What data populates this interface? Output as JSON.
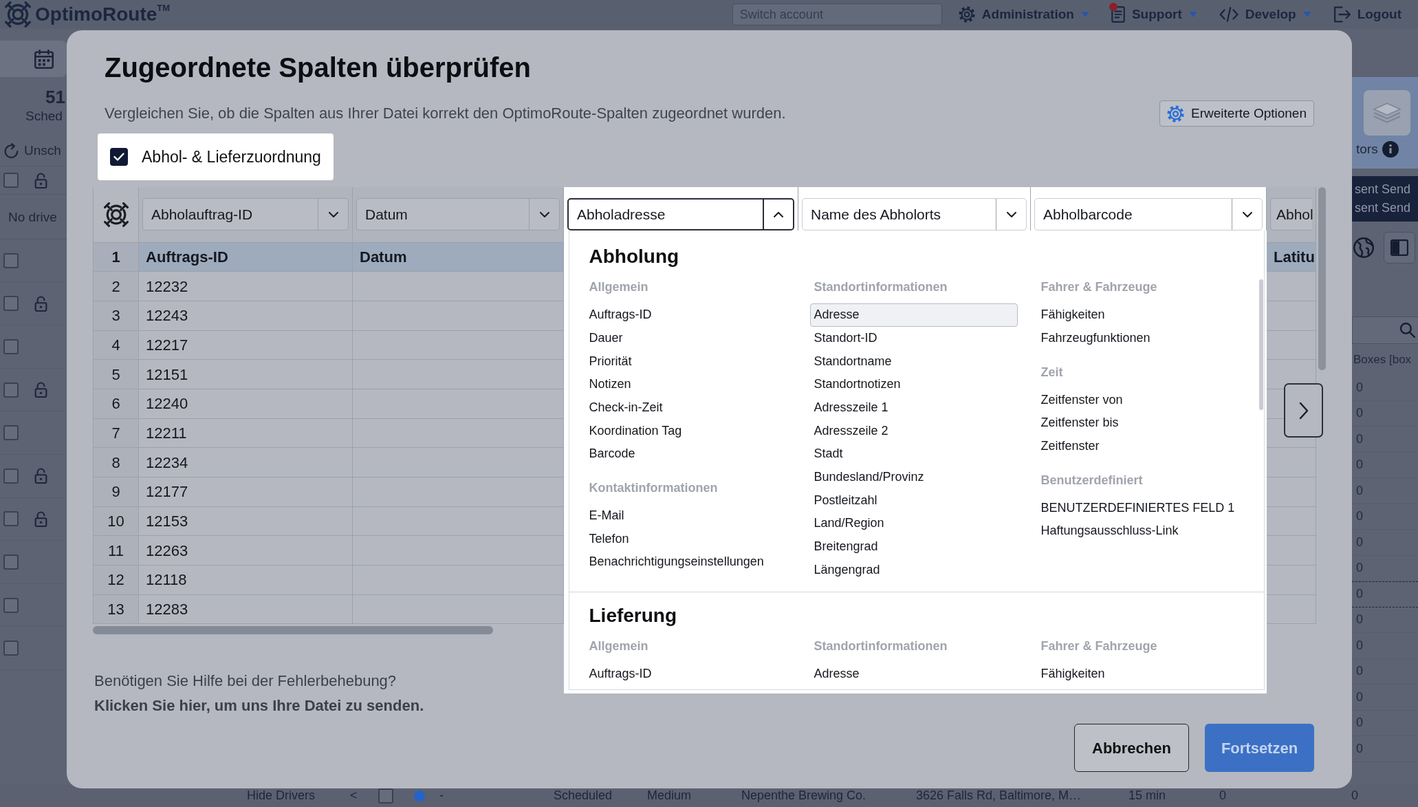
{
  "app": {
    "logo": "OptimoRoute$^{TM}$",
    "account_search": {
      "placeholder": "Switch account"
    },
    "menu": [
      {
        "label": "Administration",
        "dropdown": true,
        "notification": false
      },
      {
        "label": "Support",
        "dropdown": true,
        "notification": true
      },
      {
        "label": "Develop",
        "dropdown": true,
        "notification": false
      },
      {
        "label": "Logout",
        "dropdown": false,
        "notification": false
      }
    ],
    "left_panel": {
      "stat_value": "51",
      "stat_label": "Sched",
      "filter_label": "Unsch",
      "header_row": {
        "checked": false,
        "locked": true
      },
      "empty_text": "No drive",
      "rows": [
        {
          "checked": false,
          "locked": false
        },
        {
          "checked": false,
          "locked": true
        },
        {
          "checked": false,
          "locked": false
        },
        {
          "checked": false,
          "locked": true
        },
        {
          "checked": false,
          "locked": false
        },
        {
          "checked": false,
          "locked": true
        },
        {
          "checked": false,
          "locked": true
        },
        {
          "checked": false,
          "locked": false
        },
        {
          "checked": false,
          "locked": false
        },
        {
          "checked": false,
          "locked": false
        }
      ]
    },
    "right_panel": {
      "label": "tors",
      "notices": [
        {
          "text": "sent",
          "link": "Send"
        },
        {
          "text": "sent",
          "link": "Send"
        }
      ],
      "column_heading": "Boxes [box",
      "values": [
        {
          "text": "0",
          "highlighted": false
        },
        {
          "text": "0",
          "highlighted": false
        },
        {
          "text": "0",
          "highlighted": false
        },
        {
          "text": "0",
          "highlighted": false
        },
        {
          "text": "0",
          "highlighted": false
        },
        {
          "text": "0",
          "highlighted": false
        },
        {
          "text": "0",
          "highlighted": false
        },
        {
          "text": "0",
          "highlighted": false
        },
        {
          "text": "0",
          "highlighted": true
        },
        {
          "text": "0",
          "highlighted": false
        },
        {
          "text": "0",
          "highlighted": false
        },
        {
          "text": "0",
          "highlighted": false
        },
        {
          "text": "0",
          "highlighted": false
        },
        {
          "text": "0",
          "highlighted": false
        },
        {
          "text": "0",
          "highlighted": false
        }
      ]
    },
    "bottom_row": {
      "toggle": "Hide Drivers",
      "pager": "<",
      "checked": false,
      "color": "#2563c9",
      "cells": [
        "-",
        "Scheduled",
        "Medium",
        "Nepenthe Brewing Co.",
        "3626 Falls Rd, Baltimore, M…",
        "15 min",
        "0"
      ],
      "end_value": "0"
    }
  },
  "modal": {
    "title": "Zugeordnete Spalten überprüfen",
    "subtitle": "Vergleichen Sie, ob die Spalten aus Ihrer Datei korrekt den OptimoRoute-Spalten zugeordnet wurden.",
    "options_button": "Erweiterte Optionen",
    "mapping_toggle": {
      "label": "Abhol- & Lieferzuordnung",
      "checked": true
    },
    "table": {
      "columns": [
        {
          "select": "Abholauftrag-ID",
          "expanded": false,
          "highlighted": false
        },
        {
          "select": "Datum",
          "expanded": false,
          "highlighted": false
        },
        {
          "select": "Abholadresse",
          "expanded": true,
          "highlighted": true
        },
        {
          "select": "Name des Abholorts",
          "expanded": false,
          "highlighted": true
        },
        {
          "select": "Abholbarcode",
          "expanded": false,
          "highlighted": true
        },
        {
          "select": "Abhol",
          "highlighted": false
        }
      ],
      "rows": [
        {
          "number": "1",
          "header": true,
          "order_id": "Auftrags-ID",
          "date": "Datum",
          "column_6": "Latitu"
        },
        {
          "number": "2",
          "header": false,
          "order_id": "12232"
        },
        {
          "number": "3",
          "header": false,
          "order_id": "12243"
        },
        {
          "number": "4",
          "header": false,
          "order_id": "12217"
        },
        {
          "number": "5",
          "header": false,
          "order_id": "12151"
        },
        {
          "number": "6",
          "header": false,
          "order_id": "12240"
        },
        {
          "number": "7",
          "header": false,
          "order_id": "12211"
        },
        {
          "number": "8",
          "header": false,
          "order_id": "12234"
        },
        {
          "number": "9",
          "header": false,
          "order_id": "12177"
        },
        {
          "number": "10",
          "header": false,
          "order_id": "12153"
        },
        {
          "number": "11",
          "header": false,
          "order_id": "12263"
        },
        {
          "number": "12",
          "header": false,
          "order_id": "12118"
        },
        {
          "number": "13",
          "header": false,
          "order_id": "12283"
        }
      ]
    },
    "dropdown": {
      "sections": [
        {
          "title": "Abholung",
          "columns": [
            {
              "groups": [
                {
                  "heading": "Allgemein",
                  "items": [
                    {
                      "label": "Auftrags-ID",
                      "selected": false
                    },
                    {
                      "label": "Dauer",
                      "selected": false
                    },
                    {
                      "label": "Priorität",
                      "selected": false
                    },
                    {
                      "label": "Notizen",
                      "selected": false
                    },
                    {
                      "label": "Check-in-Zeit",
                      "selected": false
                    },
                    {
                      "label": "Koordination Tag",
                      "selected": false
                    },
                    {
                      "label": "Barcode",
                      "selected": false
                    }
                  ]
                },
                {
                  "heading": "Kontaktinformationen",
                  "items": [
                    {
                      "label": "E-Mail",
                      "selected": false
                    },
                    {
                      "label": "Telefon",
                      "selected": false
                    },
                    {
                      "label": "Benachrichtigungseinstellungen",
                      "selected": false
                    }
                  ]
                }
              ]
            },
            {
              "groups": [
                {
                  "heading": "Standortinformationen",
                  "items": [
                    {
                      "label": "Adresse",
                      "selected": true
                    },
                    {
                      "label": "Standort-ID",
                      "selected": false
                    },
                    {
                      "label": "Standortname",
                      "selected": false
                    },
                    {
                      "label": "Standortnotizen",
                      "selected": false
                    },
                    {
                      "label": "Adresszeile 1",
                      "selected": false
                    },
                    {
                      "label": "Adresszeile 2",
                      "selected": false
                    },
                    {
                      "label": "Stadt",
                      "selected": false
                    },
                    {
                      "label": "Bundesland/Provinz",
                      "selected": false
                    },
                    {
                      "label": "Postleitzahl",
                      "selected": false
                    },
                    {
                      "label": "Land/Region",
                      "selected": false
                    },
                    {
                      "label": "Breitengrad",
                      "selected": false
                    },
                    {
                      "label": "Längengrad",
                      "selected": false
                    }
                  ]
                }
              ]
            },
            {
              "groups": [
                {
                  "heading": "Fahrer & Fahrzeuge",
                  "items": [
                    {
                      "label": "Fähigkeiten",
                      "selected": false
                    },
                    {
                      "label": "Fahrzeugfunktionen",
                      "selected": false
                    }
                  ]
                },
                {
                  "heading": "Zeit",
                  "items": [
                    {
                      "label": "Zeitfenster von",
                      "selected": false
                    },
                    {
                      "label": "Zeitfenster bis",
                      "selected": false
                    },
                    {
                      "label": "Zeitfenster",
                      "selected": false
                    }
                  ]
                },
                {
                  "heading": "Benutzerdefiniert",
                  "items": [
                    {
                      "label": "BENUTZERDEFINIERTES FELD 1",
                      "selected": false
                    },
                    {
                      "label": "Haftungsausschluss-Link",
                      "selected": false
                    }
                  ]
                }
              ]
            }
          ]
        },
        {
          "title": "Lieferung",
          "columns": [
            {
              "groups": [
                {
                  "heading": "Allgemein",
                  "items": [
                    {
                      "label": "Auftrags-ID",
                      "selected": false
                    }
                  ]
                }
              ]
            },
            {
              "groups": [
                {
                  "heading": "Standortinformationen",
                  "items": [
                    {
                      "label": "Adresse",
                      "selected": false
                    }
                  ]
                }
              ]
            },
            {
              "groups": [
                {
                  "heading": "Fahrer & Fahrzeuge",
                  "items": [
                    {
                      "label": "Fähigkeiten",
                      "selected": false
                    }
                  ]
                }
              ]
            }
          ]
        }
      ]
    },
    "help": {
      "text": "Benötigen Sie Hilfe bei der Fehlerbehebung?",
      "link": "Klicken Sie hier, um uns Ihre Datei zu senden."
    },
    "buttons": [
      {
        "label": "Abbrechen",
        "kind": "secondary"
      },
      {
        "label": "Fortsetzen",
        "kind": "primary"
      }
    ]
  }
}
